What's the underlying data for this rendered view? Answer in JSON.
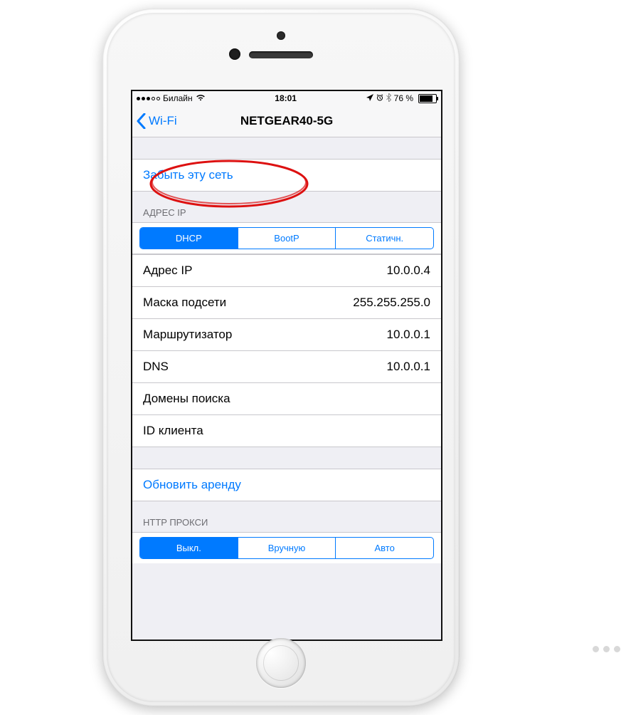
{
  "statusbar": {
    "carrier": "Билайн",
    "time": "18:01",
    "battery_pct": "76 %"
  },
  "nav": {
    "back_label": "Wi-Fi",
    "title": "NETGEAR40-5G"
  },
  "forget": {
    "label": "Забыть эту сеть"
  },
  "ip_section": {
    "header": "АДРЕС IP",
    "segments": {
      "dhcp": "DHCP",
      "bootp": "BootP",
      "static": "Статичн."
    },
    "rows": {
      "ip_label": "Адрес IP",
      "ip_value": "10.0.0.4",
      "mask_label": "Маска подсети",
      "mask_value": "255.255.255.0",
      "router_label": "Маршрутизатор",
      "router_value": "10.0.0.1",
      "dns_label": "DNS",
      "dns_value": "10.0.0.1",
      "search_label": "Домены поиска",
      "search_value": "",
      "client_label": "ID клиента",
      "client_value": ""
    }
  },
  "renew": {
    "label": "Обновить аренду"
  },
  "proxy_section": {
    "header": "HTTP ПРОКСИ",
    "segments": {
      "off": "Выкл.",
      "manual": "Вручную",
      "auto": "Авто"
    }
  }
}
